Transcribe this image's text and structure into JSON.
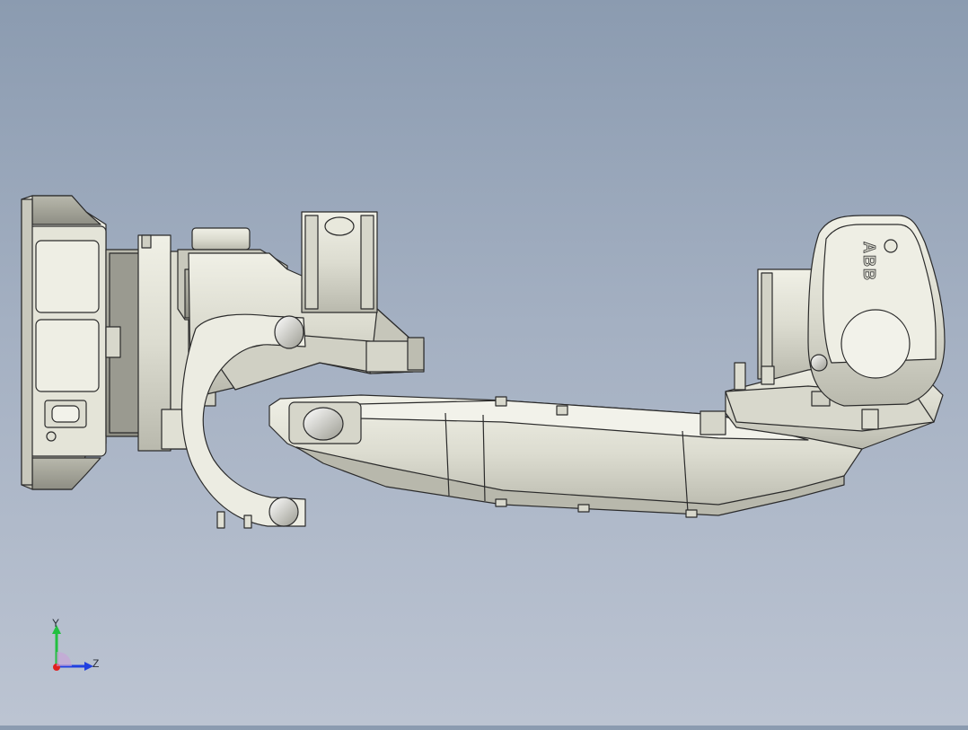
{
  "scene": {
    "background_top": "#8b9bb0",
    "background_bottom": "#bcc4d2",
    "part_fill": "#e8e8de",
    "part_shade": "#c9c9bd",
    "edge_color": "#2b2b2b"
  },
  "model": {
    "brand_text": "ABB"
  },
  "triad": {
    "y_label": "Y",
    "z_label": "Z",
    "y_color": "#22c040",
    "z_color": "#2040e0",
    "x_color": "#e02020"
  }
}
